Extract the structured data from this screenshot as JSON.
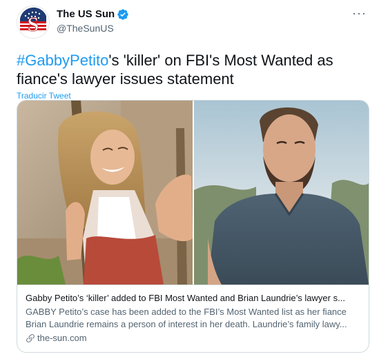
{
  "author": {
    "display_name": "The US Sun",
    "handle": "@TheSunUS",
    "verified": true,
    "avatar_icon": "the-sun-logo",
    "avatar_letter": "S"
  },
  "more_icon": "···",
  "tweet": {
    "hashtag": "#GabbyPetito",
    "text_rest": "'s 'killer' on FBI's Most Wanted as fiance's lawyer issues statement",
    "translate_label": "Traducir Tweet"
  },
  "card": {
    "title": "Gabby Petito’s ‘killer’ added to FBI Most Wanted and Brian Laundrie’s lawyer s...",
    "description": "GABBY Petito’s case has been added to the FBI’s Most Wanted list as her fiance Brian Laundrie remains a person of interest in her death. Laundrie’s family lawy...",
    "domain": "the-sun.com",
    "left_image": "woman-smiling-photo",
    "right_image": "man-portrait-photo"
  },
  "colors": {
    "accent": "#1d9bf0",
    "text": "#0f1419",
    "secondary": "#536471",
    "border": "#cfd9de"
  }
}
